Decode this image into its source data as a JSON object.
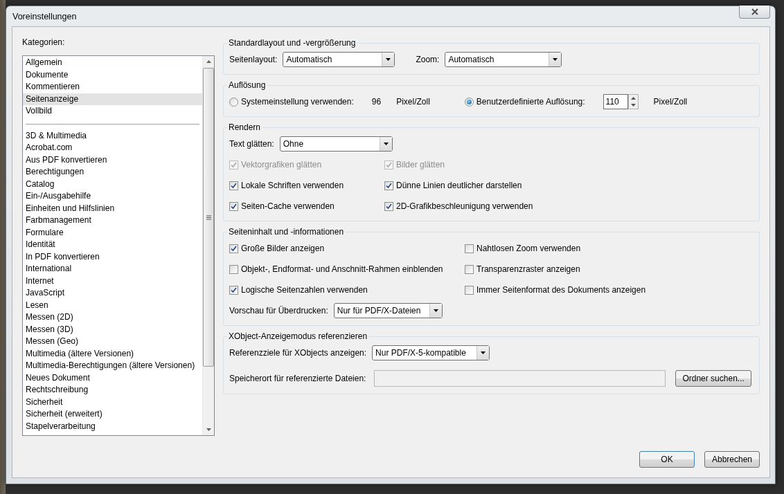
{
  "window": {
    "title": "Voreinstellungen"
  },
  "categories": {
    "label": "Kategorien:",
    "groups": [
      {
        "items": [
          {
            "label": "Allgemein",
            "selected": false
          },
          {
            "label": "Dokumente",
            "selected": false
          },
          {
            "label": "Kommentieren",
            "selected": false
          },
          {
            "label": "Seitenanzeige",
            "selected": true
          },
          {
            "label": "Vollbild",
            "selected": false
          }
        ]
      },
      {
        "items": [
          {
            "label": "3D & Multimedia",
            "selected": false
          },
          {
            "label": "Acrobat.com",
            "selected": false
          },
          {
            "label": "Aus PDF konvertieren",
            "selected": false
          },
          {
            "label": "Berechtigungen",
            "selected": false
          },
          {
            "label": "Catalog",
            "selected": false
          },
          {
            "label": "Ein-/Ausgabehilfe",
            "selected": false
          },
          {
            "label": "Einheiten und Hilfslinien",
            "selected": false
          },
          {
            "label": "Farbmanagement",
            "selected": false
          },
          {
            "label": "Formulare",
            "selected": false
          },
          {
            "label": "Identität",
            "selected": false
          },
          {
            "label": "In PDF konvertieren",
            "selected": false
          },
          {
            "label": "International",
            "selected": false
          },
          {
            "label": "Internet",
            "selected": false
          },
          {
            "label": "JavaScript",
            "selected": false
          },
          {
            "label": "Lesen",
            "selected": false
          },
          {
            "label": "Messen (2D)",
            "selected": false
          },
          {
            "label": "Messen (3D)",
            "selected": false
          },
          {
            "label": "Messen (Geo)",
            "selected": false
          },
          {
            "label": "Multimedia (ältere Versionen)",
            "selected": false
          },
          {
            "label": "Multimedia-Berechtigungen (ältere Versionen)",
            "selected": false
          },
          {
            "label": "Neues Dokument",
            "selected": false
          },
          {
            "label": "Rechtschreibung",
            "selected": false
          },
          {
            "label": "Sicherheit",
            "selected": false
          },
          {
            "label": "Sicherheit (erweitert)",
            "selected": false
          },
          {
            "label": "Stapelverarbeitung",
            "selected": false
          }
        ]
      }
    ]
  },
  "sections": [
    {
      "kind": "layout",
      "title": "Standardlayout und -vergrößerung",
      "rows": [
        {
          "items": [
            {
              "kind": "dropdown",
              "label": "Seitenlayout:",
              "value": "Automatisch"
            },
            {
              "kind": "dropdown",
              "label": "Zoom:",
              "value": "Automatisch"
            }
          ]
        }
      ]
    },
    {
      "kind": "resolution",
      "title": "Auflösung",
      "rows": [
        {
          "items": [
            {
              "kind": "radio",
              "label": "Systemeinstellung verwenden:",
              "selected": false
            },
            {
              "kind": "text",
              "text": "96"
            },
            {
              "kind": "text",
              "text": "Pixel/Zoll"
            },
            {
              "kind": "radio",
              "label": "Benutzerdefinierte Auflösung:",
              "selected": true
            },
            {
              "kind": "spin",
              "value": "110"
            },
            {
              "kind": "text",
              "text": "Pixel/Zoll"
            }
          ]
        }
      ]
    },
    {
      "kind": "render",
      "title": "Rendern",
      "rows": [
        {
          "items": [
            {
              "kind": "dropdown",
              "label": "Text glätten:",
              "value": "Ohne"
            }
          ]
        },
        {
          "items": [
            {
              "kind": "checkbox",
              "label": "Vektorgrafiken glätten",
              "checked": true,
              "disabled": true
            },
            {
              "kind": "checkbox",
              "label": "Bilder glätten",
              "checked": true,
              "disabled": true
            }
          ]
        },
        {
          "items": [
            {
              "kind": "checkbox",
              "label": "Lokale Schriften verwenden",
              "checked": true,
              "disabled": false
            },
            {
              "kind": "checkbox",
              "label": "Dünne Linien deutlicher darstellen",
              "checked": true,
              "disabled": false
            }
          ]
        },
        {
          "items": [
            {
              "kind": "checkbox",
              "label": "Seiten-Cache verwenden",
              "checked": true,
              "disabled": false
            },
            {
              "kind": "checkbox",
              "label": "2D-Grafikbeschleunigung verwenden",
              "checked": true,
              "disabled": false
            }
          ]
        }
      ]
    },
    {
      "kind": "content",
      "title": "Seiteninhalt und -informationen",
      "rows": [
        {
          "items": [
            {
              "kind": "checkbox",
              "label": "Große Bilder anzeigen",
              "checked": true,
              "disabled": false
            },
            {
              "kind": "checkbox",
              "label": "Nahtlosen Zoom verwenden",
              "checked": false,
              "disabled": false
            }
          ]
        },
        {
          "items": [
            {
              "kind": "checkbox",
              "label": "Objekt-, Endformat- und Anschnitt-Rahmen einblenden",
              "checked": false,
              "disabled": false
            },
            {
              "kind": "checkbox",
              "label": "Transparenzraster anzeigen",
              "checked": false,
              "disabled": false
            }
          ]
        },
        {
          "items": [
            {
              "kind": "checkbox",
              "label": "Logische Seitenzahlen verwenden",
              "checked": true,
              "disabled": false
            },
            {
              "kind": "checkbox",
              "label": "Immer Seitenformat des Dokuments anzeigen",
              "checked": false,
              "disabled": false
            }
          ]
        },
        {
          "items": [
            {
              "kind": "dropdown",
              "label": "Vorschau für Überdrucken:",
              "value": "Nur für PDF/X-Dateien"
            }
          ]
        }
      ]
    },
    {
      "kind": "xobject",
      "title": "XObject-Anzeigemodus referenzieren",
      "rows": [
        {
          "items": [
            {
              "kind": "dropdown",
              "label": "Referenzziele für XObjects anzeigen:",
              "value": "Nur PDF/X-5-kompatible"
            }
          ]
        },
        {
          "items": [
            {
              "kind": "field",
              "label": "Speicherort für referenzierte Dateien:",
              "disabled": true
            },
            {
              "kind": "button",
              "label": "Ordner suchen..."
            }
          ]
        }
      ]
    }
  ],
  "buttons": [
    {
      "label": "OK",
      "default": true
    },
    {
      "label": "Abbrechen",
      "default": false
    }
  ]
}
